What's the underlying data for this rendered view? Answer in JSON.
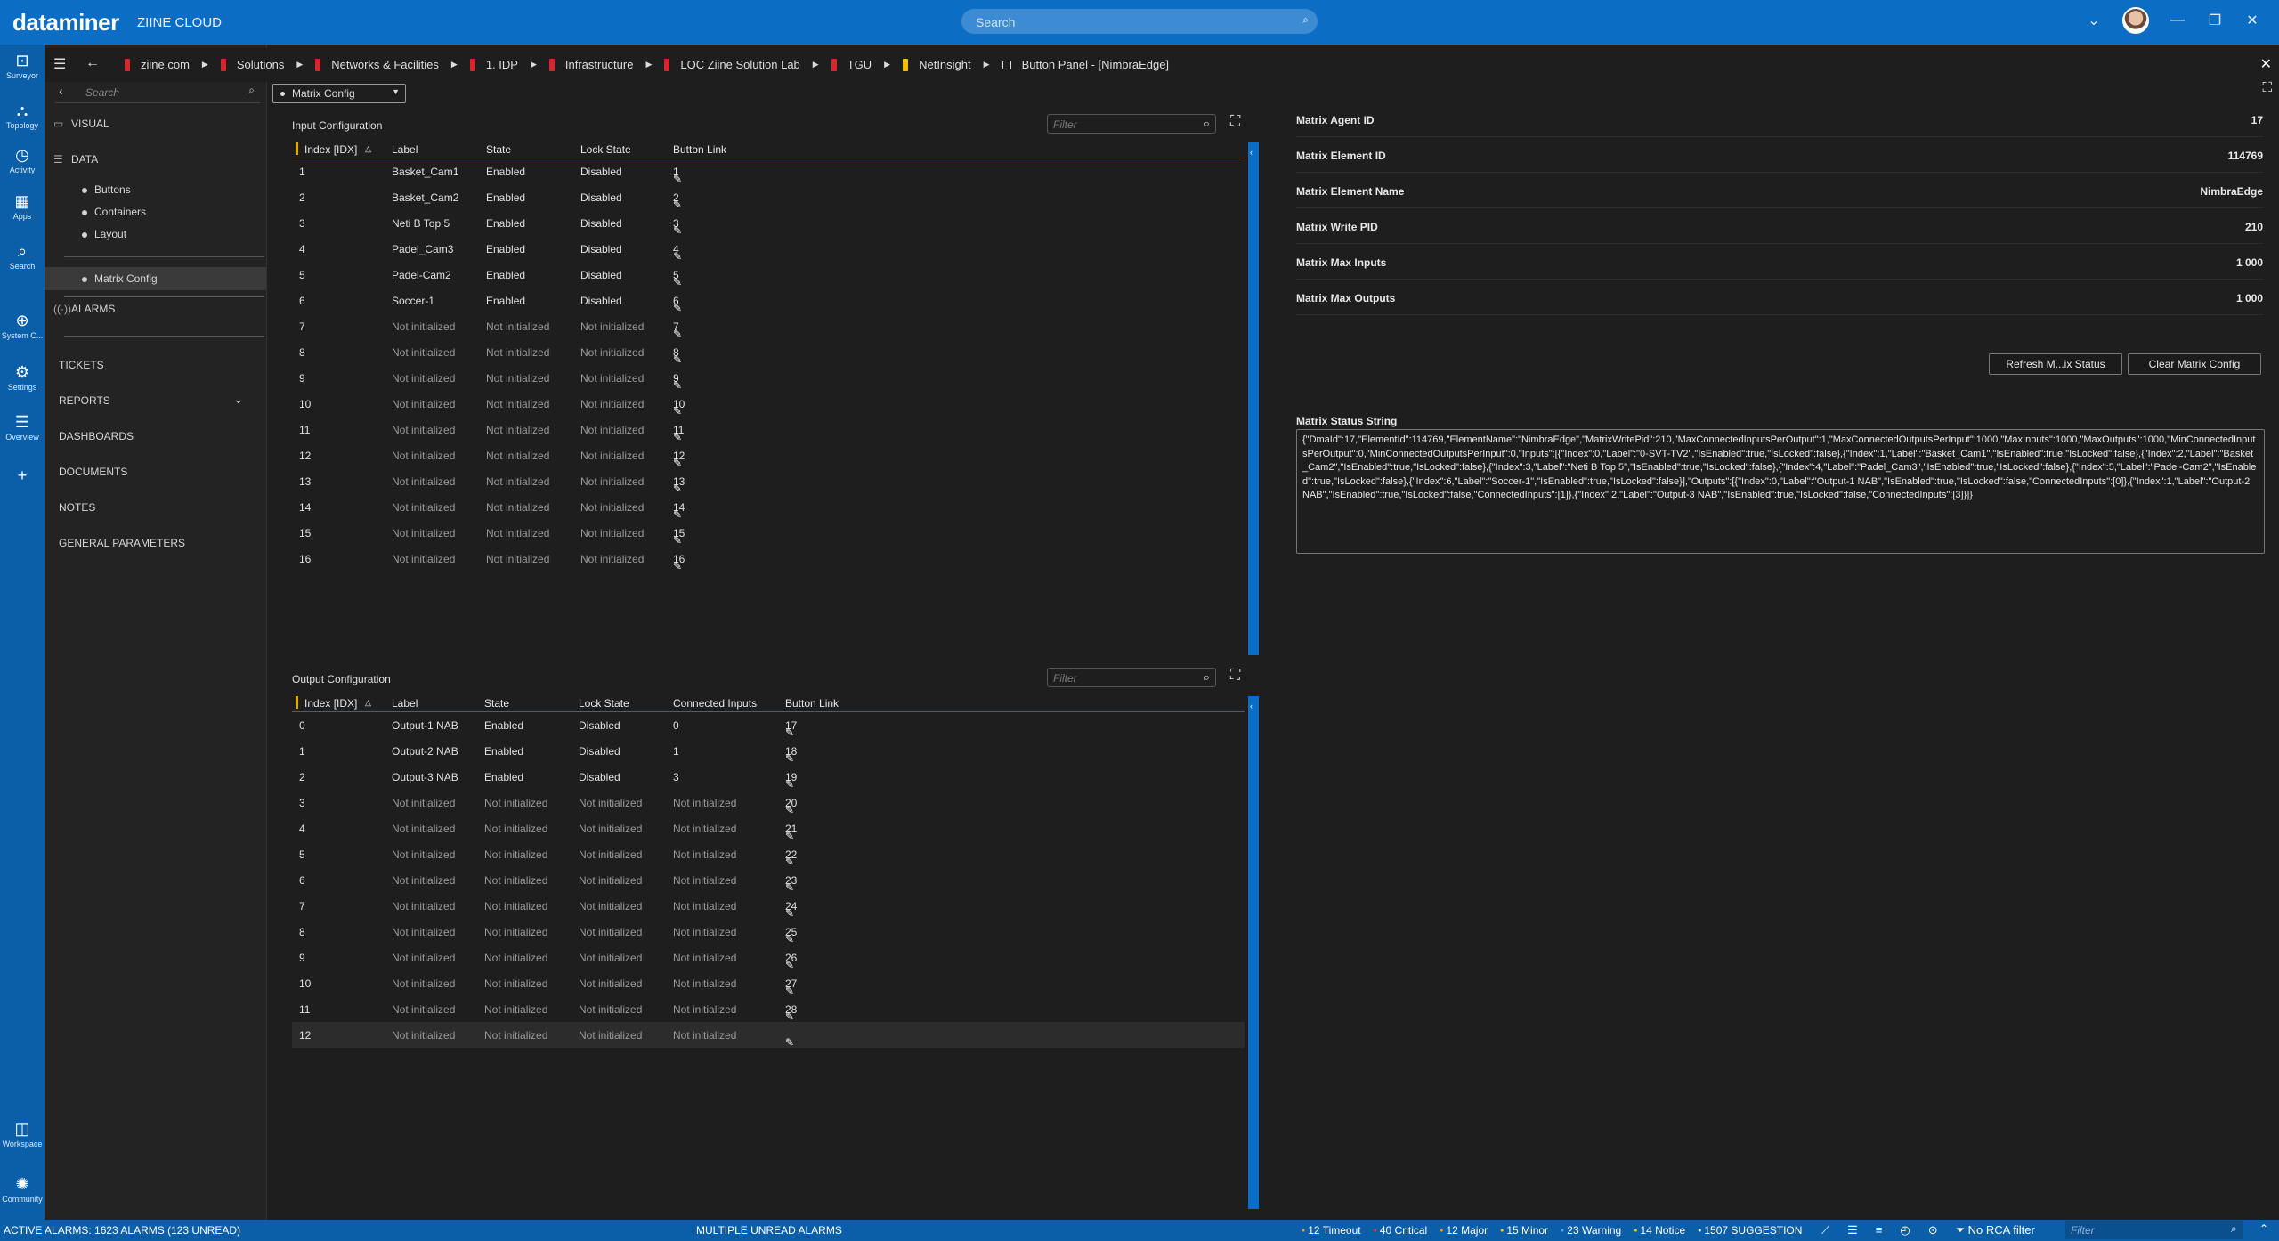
{
  "app": {
    "brand": "dataminer",
    "cloud": "ZIINE CLOUD",
    "search_placeholder": "Search"
  },
  "window_controls": {
    "dropdown": "⌄",
    "minimize": "—",
    "restore": "❐",
    "close": "✕"
  },
  "rail": [
    {
      "label": "Surveyor",
      "icon": "surveyor-icon",
      "glyph": "⊡"
    },
    {
      "label": "Topology",
      "icon": "topology-icon",
      "glyph": "⛬"
    },
    {
      "label": "Activity",
      "icon": "activity-icon",
      "glyph": "◷"
    },
    {
      "label": "Apps",
      "icon": "apps-icon",
      "glyph": "▦"
    },
    {
      "label": "Search",
      "icon": "search-icon",
      "glyph": "⌕"
    },
    {
      "label": "System C...",
      "icon": "globe-icon",
      "glyph": "⊕"
    },
    {
      "label": "Settings",
      "icon": "gear-icon",
      "glyph": "⚙"
    },
    {
      "label": "Overview",
      "icon": "list-icon",
      "glyph": "☰"
    },
    {
      "label": "",
      "icon": "plus-icon",
      "glyph": "+"
    },
    {
      "label": "Workspace",
      "icon": "workspace-icon",
      "glyph": "◫"
    },
    {
      "label": "Community",
      "icon": "community-icon",
      "glyph": "✺"
    }
  ],
  "subnav": {
    "search_placeholder": "Search",
    "visual": "VISUAL",
    "data": "DATA",
    "data_items": [
      "Buttons",
      "Containers",
      "Layout"
    ],
    "active": "Matrix Config",
    "alarms": "ALARMS",
    "sections": [
      "TICKETS",
      "REPORTS",
      "DASHBOARDS",
      "DOCUMENTS",
      "NOTES",
      "GENERAL PARAMETERS"
    ]
  },
  "breadcrumbs": [
    {
      "label": "ziine.com",
      "color": "#d7262e"
    },
    {
      "label": "Solutions",
      "color": "#d7262e"
    },
    {
      "label": "Networks & Facilities",
      "color": "#d7262e"
    },
    {
      "label": "1. IDP",
      "color": "#d7262e"
    },
    {
      "label": "Infrastructure",
      "color": "#d7262e"
    },
    {
      "label": "LOC Ziine Solution Lab",
      "color": "#d7262e"
    },
    {
      "label": "TGU",
      "color": "#d7262e"
    },
    {
      "label": "NetInsight",
      "color": "#f2c000"
    },
    {
      "label": "Button Panel - [NimbraEdge]",
      "color": "none"
    }
  ],
  "page_selector": "Matrix Config",
  "input_config": {
    "title": "Input Configuration",
    "filter_placeholder": "Filter",
    "headers": [
      "Index [IDX]",
      "Label",
      "State",
      "Lock State",
      "Button Link"
    ],
    "rows": [
      [
        "1",
        "Basket_Cam1",
        "Enabled",
        "Disabled",
        "1"
      ],
      [
        "2",
        "Basket_Cam2",
        "Enabled",
        "Disabled",
        "2"
      ],
      [
        "3",
        "Neti B Top 5",
        "Enabled",
        "Disabled",
        "3"
      ],
      [
        "4",
        "Padel_Cam3",
        "Enabled",
        "Disabled",
        "4"
      ],
      [
        "5",
        "Padel-Cam2",
        "Enabled",
        "Disabled",
        "5"
      ],
      [
        "6",
        "Soccer-1",
        "Enabled",
        "Disabled",
        "6"
      ],
      [
        "7",
        "Not initialized",
        "Not initialized",
        "Not initialized",
        "7"
      ],
      [
        "8",
        "Not initialized",
        "Not initialized",
        "Not initialized",
        "8"
      ],
      [
        "9",
        "Not initialized",
        "Not initialized",
        "Not initialized",
        "9"
      ],
      [
        "10",
        "Not initialized",
        "Not initialized",
        "Not initialized",
        "10"
      ],
      [
        "11",
        "Not initialized",
        "Not initialized",
        "Not initialized",
        "11"
      ],
      [
        "12",
        "Not initialized",
        "Not initialized",
        "Not initialized",
        "12"
      ],
      [
        "13",
        "Not initialized",
        "Not initialized",
        "Not initialized",
        "13"
      ],
      [
        "14",
        "Not initialized",
        "Not initialized",
        "Not initialized",
        "14"
      ],
      [
        "15",
        "Not initialized",
        "Not initialized",
        "Not initialized",
        "15"
      ],
      [
        "16",
        "Not initialized",
        "Not initialized",
        "Not initialized",
        "16"
      ]
    ]
  },
  "output_config": {
    "title": "Output Configuration",
    "filter_placeholder": "Filter",
    "headers": [
      "Index [IDX]",
      "Label",
      "State",
      "Lock State",
      "Connected Inputs",
      "Button Link"
    ],
    "rows": [
      [
        "0",
        "Output-1 NAB",
        "Enabled",
        "Disabled",
        "0",
        "17"
      ],
      [
        "1",
        "Output-2 NAB",
        "Enabled",
        "Disabled",
        "1",
        "18"
      ],
      [
        "2",
        "Output-3 NAB",
        "Enabled",
        "Disabled",
        "3",
        "19"
      ],
      [
        "3",
        "Not initialized",
        "Not initialized",
        "Not initialized",
        "Not initialized",
        "20"
      ],
      [
        "4",
        "Not initialized",
        "Not initialized",
        "Not initialized",
        "Not initialized",
        "21"
      ],
      [
        "5",
        "Not initialized",
        "Not initialized",
        "Not initialized",
        "Not initialized",
        "22"
      ],
      [
        "6",
        "Not initialized",
        "Not initialized",
        "Not initialized",
        "Not initialized",
        "23"
      ],
      [
        "7",
        "Not initialized",
        "Not initialized",
        "Not initialized",
        "Not initialized",
        "24"
      ],
      [
        "8",
        "Not initialized",
        "Not initialized",
        "Not initialized",
        "Not initialized",
        "25"
      ],
      [
        "9",
        "Not initialized",
        "Not initialized",
        "Not initialized",
        "Not initialized",
        "26"
      ],
      [
        "10",
        "Not initialized",
        "Not initialized",
        "Not initialized",
        "Not initialized",
        "27"
      ],
      [
        "11",
        "Not initialized",
        "Not initialized",
        "Not initialized",
        "Not initialized",
        "28"
      ],
      [
        "12",
        "Not initialized",
        "Not initialized",
        "Not initialized",
        "Not initialized",
        ""
      ]
    ]
  },
  "properties": [
    {
      "key": "Matrix Agent ID",
      "value": "17"
    },
    {
      "key": "Matrix Element ID",
      "value": "114769"
    },
    {
      "key": "Matrix Element Name",
      "value": "NimbraEdge"
    },
    {
      "key": "Matrix Write PID",
      "value": "210"
    },
    {
      "key": "Matrix Max Inputs",
      "value": "1 000"
    },
    {
      "key": "Matrix Max Outputs",
      "value": "1 000"
    }
  ],
  "buttons": {
    "refresh": "Refresh M...ix Status",
    "clear": "Clear Matrix Config"
  },
  "status_string": {
    "label": "Matrix Status String",
    "value": "{\"DmaId\":17,\"ElementId\":114769,\"ElementName\":\"NimbraEdge\",\"MatrixWritePid\":210,\"MaxConnectedInputsPerOutput\":1,\"MaxConnectedOutputsPerInput\":1000,\"MaxInputs\":1000,\"MaxOutputs\":1000,\"MinConnectedInputsPerOutput\":0,\"MinConnectedOutputsPerInput\":0,\"Inputs\":[{\"Index\":0,\"Label\":\"0-SVT-TV2\",\"IsEnabled\":true,\"IsLocked\":false},{\"Index\":1,\"Label\":\"Basket_Cam1\",\"IsEnabled\":true,\"IsLocked\":false},{\"Index\":2,\"Label\":\"Basket_Cam2\",\"IsEnabled\":true,\"IsLocked\":false},{\"Index\":3,\"Label\":\"Neti B Top 5\",\"IsEnabled\":true,\"IsLocked\":false},{\"Index\":4,\"Label\":\"Padel_Cam3\",\"IsEnabled\":true,\"IsLocked\":false},{\"Index\":5,\"Label\":\"Padel-Cam2\",\"IsEnabled\":true,\"IsLocked\":false},{\"Index\":6,\"Label\":\"Soccer-1\",\"IsEnabled\":true,\"IsLocked\":false}],\"Outputs\":[{\"Index\":0,\"Label\":\"Output-1 NAB\",\"IsEnabled\":true,\"IsLocked\":false,\"ConnectedInputs\":[0]},{\"Index\":1,\"Label\":\"Output-2 NAB\",\"IsEnabled\":true,\"IsLocked\":false,\"ConnectedInputs\":[1]},{\"Index\":2,\"Label\":\"Output-3 NAB\",\"IsEnabled\":true,\"IsLocked\":false,\"ConnectedInputs\":[3]}]}"
  },
  "statusbar": {
    "active_alarms": "ACTIVE ALARMS: 1623 ALARMS (123 UNREAD)",
    "multiple": "MULTIPLE UNREAD ALARMS",
    "severities": [
      {
        "label": "12 Timeout",
        "color": "#f0a020"
      },
      {
        "label": "40 Critical",
        "color": "#ff3030"
      },
      {
        "label": "12 Major",
        "color": "#ff9900"
      },
      {
        "label": "15 Minor",
        "color": "#ffd700"
      },
      {
        "label": "23 Warning",
        "color": "#3cb0ff"
      },
      {
        "label": "14 Notice",
        "color": "#f0d000"
      },
      {
        "label": "1507 SUGGESTION",
        "color": "#ffffff"
      }
    ],
    "rca": "No RCA filter",
    "filter_placeholder": "Filter"
  }
}
